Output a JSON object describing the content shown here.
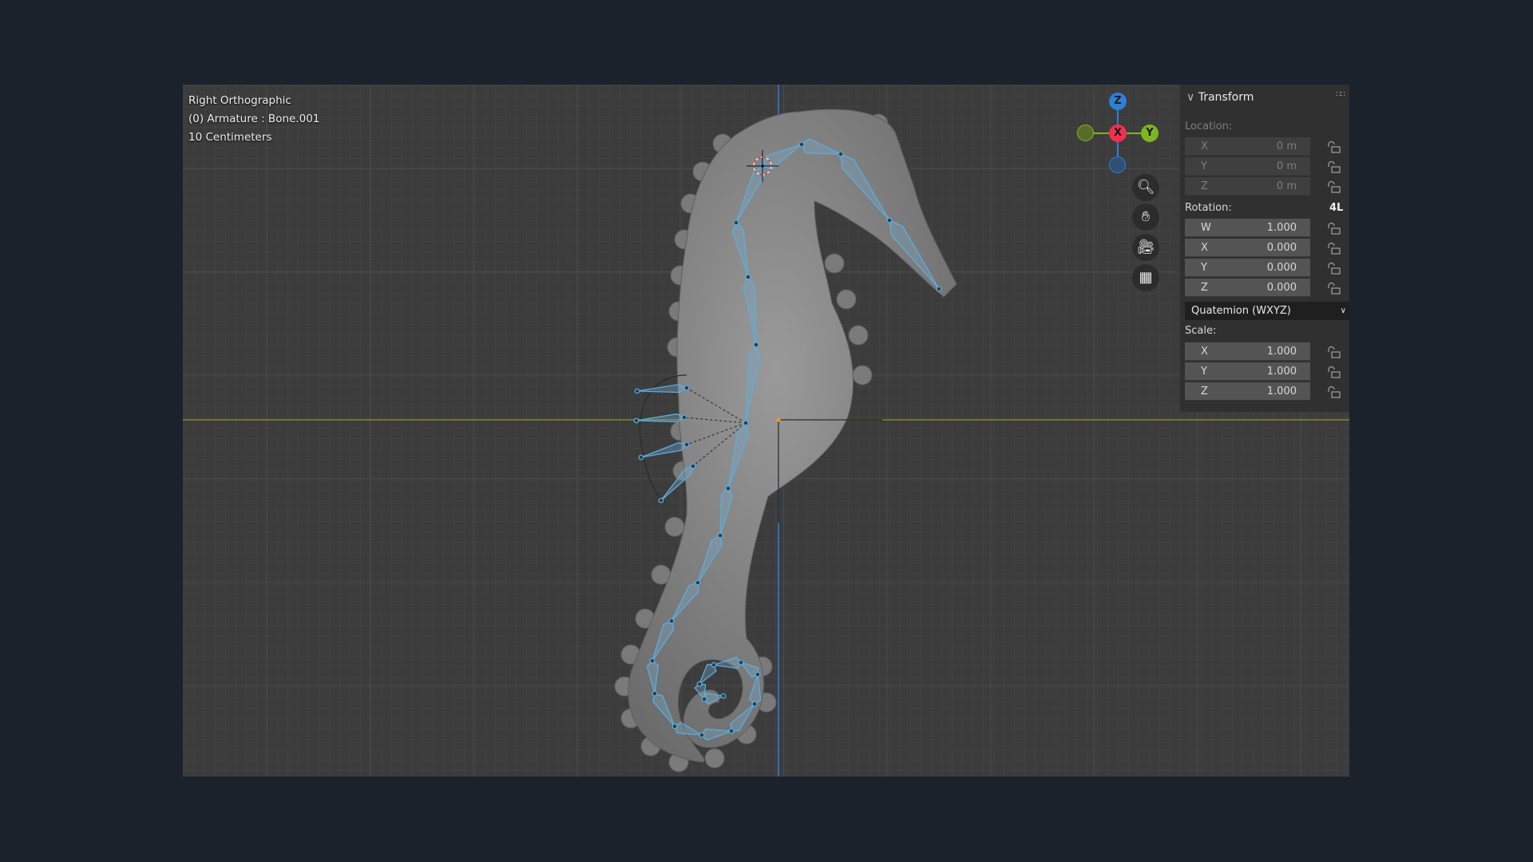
{
  "viewport": {
    "view_name": "Right Orthographic",
    "active_object": "(0) Armature : Bone.001",
    "grid_scale": "10 Centimeters"
  },
  "gizmo": {
    "z": "Z",
    "x": "X",
    "y": "Y",
    "colors": {
      "x": "#f0304f",
      "y": "#7fb51f",
      "z": "#2e7fd6"
    }
  },
  "nav_buttons": [
    {
      "icon": "zoom-icon"
    },
    {
      "icon": "hand-pan-icon"
    },
    {
      "icon": "camera-icon"
    },
    {
      "icon": "grid-icon"
    }
  ],
  "transform_panel": {
    "title": "Transform",
    "location": {
      "label": "Location:",
      "fields": [
        {
          "axis": "X",
          "value": "0 m"
        },
        {
          "axis": "Y",
          "value": "0 m"
        },
        {
          "axis": "Z",
          "value": "0 m"
        }
      ]
    },
    "rotation": {
      "label": "Rotation:",
      "mode_badge": "4L",
      "fields": [
        {
          "axis": "W",
          "value": "1.000"
        },
        {
          "axis": "X",
          "value": "0.000"
        },
        {
          "axis": "Y",
          "value": "0.000"
        },
        {
          "axis": "Z",
          "value": "0.000"
        }
      ]
    },
    "rotation_mode": "Quatemion (WXYZ)",
    "scale": {
      "label": "Scale:",
      "fields": [
        {
          "axis": "X",
          "value": "1.000"
        },
        {
          "axis": "Y",
          "value": "1.000"
        },
        {
          "axis": "Z",
          "value": "1.000"
        }
      ]
    }
  },
  "colors": {
    "bone": "#5aaee0",
    "mesh": "#8a8a8a",
    "x_axis_line": "#2e7fd6",
    "y_axis_line": "#7e8a2c"
  }
}
